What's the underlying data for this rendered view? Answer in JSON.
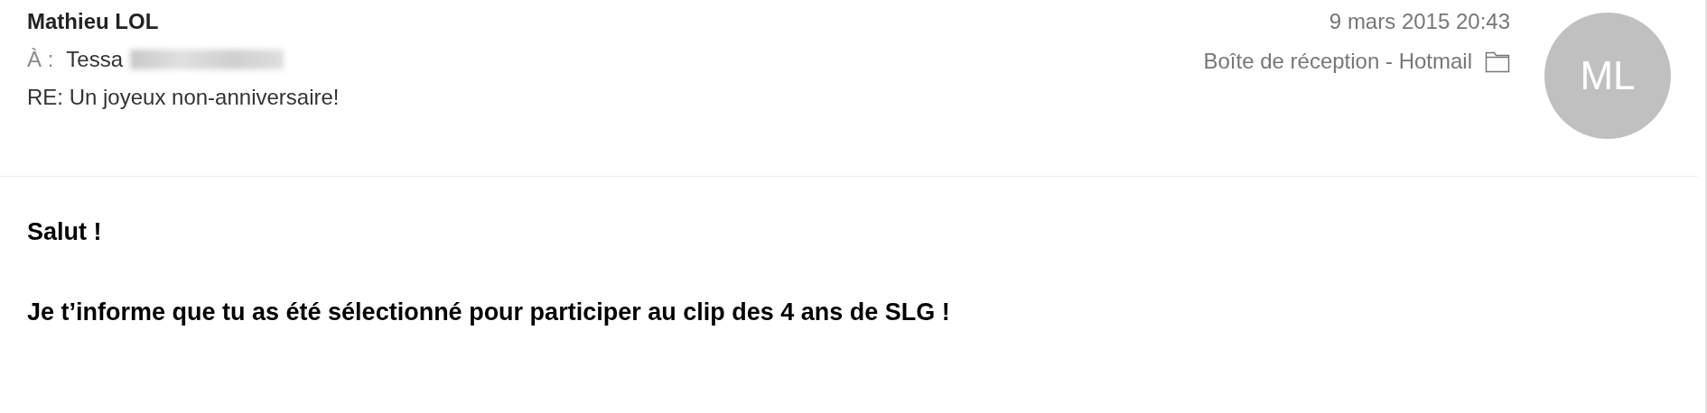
{
  "header": {
    "sender": "Mathieu LOL",
    "to_label": "À :",
    "to_name": "Tessa",
    "subject": "RE: Un joyeux non-anniversaire!",
    "date": "9 mars 2015 20:43",
    "mailbox": "Boîte de réception - Hotmail",
    "avatar_initials": "ML"
  },
  "body": [
    "Salut !",
    "Je t’informe que tu as été sélectionné pour participer au clip des 4 ans de SLG !"
  ]
}
